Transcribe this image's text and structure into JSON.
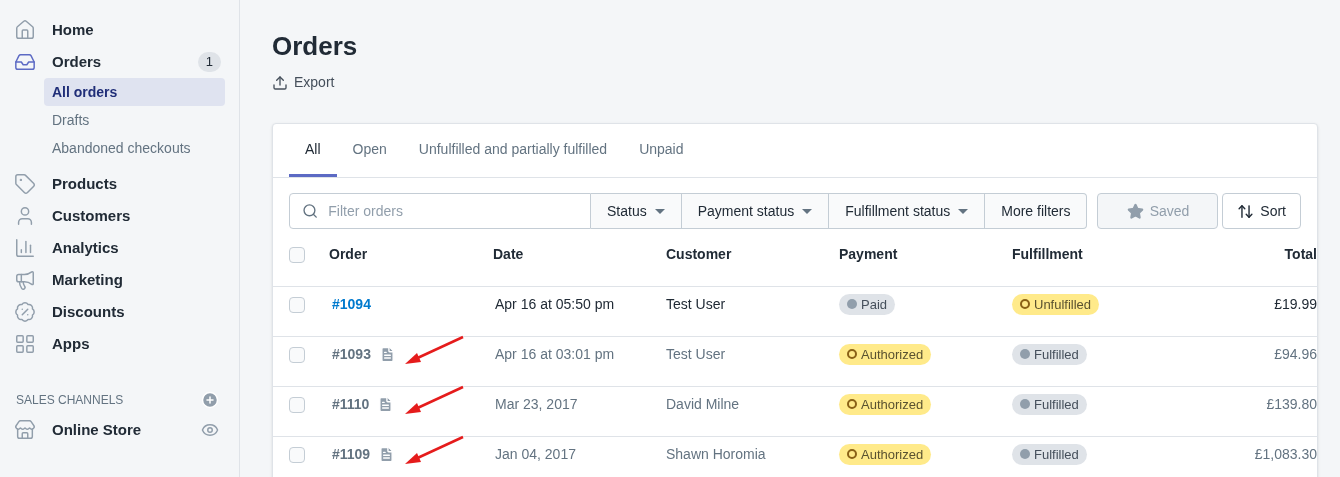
{
  "sidebar": {
    "items": [
      {
        "label": "Home",
        "selected": false
      },
      {
        "label": "Orders",
        "selected": true,
        "badge": "1",
        "children": [
          {
            "label": "All orders",
            "selected": true
          },
          {
            "label": "Drafts",
            "selected": false
          },
          {
            "label": "Abandoned checkouts",
            "selected": false
          }
        ]
      },
      {
        "label": "Products",
        "selected": false
      },
      {
        "label": "Customers",
        "selected": false
      },
      {
        "label": "Analytics",
        "selected": false
      },
      {
        "label": "Marketing",
        "selected": false
      },
      {
        "label": "Discounts",
        "selected": false
      },
      {
        "label": "Apps",
        "selected": false
      }
    ],
    "section_title": "SALES CHANNELS",
    "channels": [
      {
        "label": "Online Store"
      }
    ]
  },
  "page": {
    "title": "Orders",
    "action": "Export"
  },
  "tabs": [
    {
      "label": "All",
      "selected": true
    },
    {
      "label": "Open",
      "selected": false
    },
    {
      "label": "Unfulfilled and partially fulfilled",
      "selected": false
    },
    {
      "label": "Unpaid",
      "selected": false
    }
  ],
  "filters": {
    "placeholder": "Filter orders",
    "dropdowns": [
      "Status",
      "Payment status",
      "Fulfillment status"
    ],
    "more": "More filters",
    "saved": {
      "label": "Saved",
      "disabled": true
    },
    "sort": "Sort"
  },
  "table": {
    "all_checked": false,
    "columns": [
      "Order",
      "Date",
      "Customer",
      "Payment",
      "Fulfillment",
      "Total"
    ],
    "rows": [
      {
        "order": "#1094",
        "date": "Apr 16 at 05:50 pm",
        "customer": "Test User",
        "payment": {
          "label": "Paid",
          "kind": "complete"
        },
        "fulfillment": {
          "label": "Unfulfilled",
          "kind": "attention"
        },
        "total": "£19.99",
        "unread": true,
        "note": false,
        "checked": false,
        "arrow": false
      },
      {
        "order": "#1093",
        "date": "Apr 16 at 03:01 pm",
        "customer": "Test User",
        "payment": {
          "label": "Authorized",
          "kind": "attention"
        },
        "fulfillment": {
          "label": "Fulfilled",
          "kind": "complete"
        },
        "total": "£94.96",
        "unread": false,
        "note": true,
        "checked": false,
        "arrow": true
      },
      {
        "order": "#1110",
        "date": "Mar 23, 2017",
        "customer": "David Milne",
        "payment": {
          "label": "Authorized",
          "kind": "attention"
        },
        "fulfillment": {
          "label": "Fulfilled",
          "kind": "complete"
        },
        "total": "£139.80",
        "unread": false,
        "note": true,
        "checked": false,
        "arrow": true
      },
      {
        "order": "#1109",
        "date": "Jan 04, 2017",
        "customer": "Shawn Horomia",
        "payment": {
          "label": "Authorized",
          "kind": "attention"
        },
        "fulfillment": {
          "label": "Fulfilled",
          "kind": "complete"
        },
        "total": "£1,083.30",
        "unread": false,
        "note": true,
        "checked": false,
        "arrow": true
      }
    ]
  }
}
